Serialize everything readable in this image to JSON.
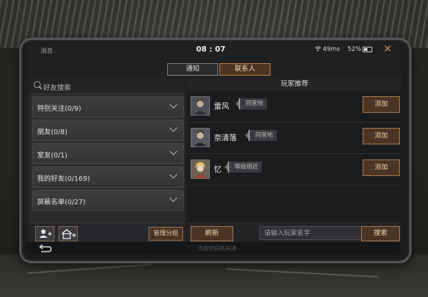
{
  "status_bar": {
    "left_label": "消息",
    "time": "08 : 07",
    "network_speed": "49ms",
    "battery_percent": "52%",
    "battery_level": 0.52
  },
  "tabs": [
    {
      "label": "通知",
      "active": false
    },
    {
      "label": "联系人",
      "active": true
    }
  ],
  "friends": {
    "search_placeholder": "好友搜索",
    "groups": [
      {
        "label": "特别关注(0/9)"
      },
      {
        "label": "朋友(0/8)"
      },
      {
        "label": "室友(0/1)"
      },
      {
        "label": "我的好友(0/169)"
      },
      {
        "label": "屏蔽名单(0/27)"
      }
    ],
    "manage_label": "管理分组"
  },
  "recommend": {
    "title": "玩家推荐",
    "players": [
      {
        "name": "雷风",
        "tag": "同营地",
        "add_label": "添加"
      },
      {
        "name": "奈清落",
        "tag": "同营地",
        "add_label": "添加"
      },
      {
        "name": "忆",
        "tag": "等级相近",
        "add_label": "添加"
      }
    ],
    "refresh_label": "刷新",
    "input_placeholder": "请输入玩家名字",
    "search_label": "搜索"
  },
  "bottom_hint": "点击空白处关闭"
}
